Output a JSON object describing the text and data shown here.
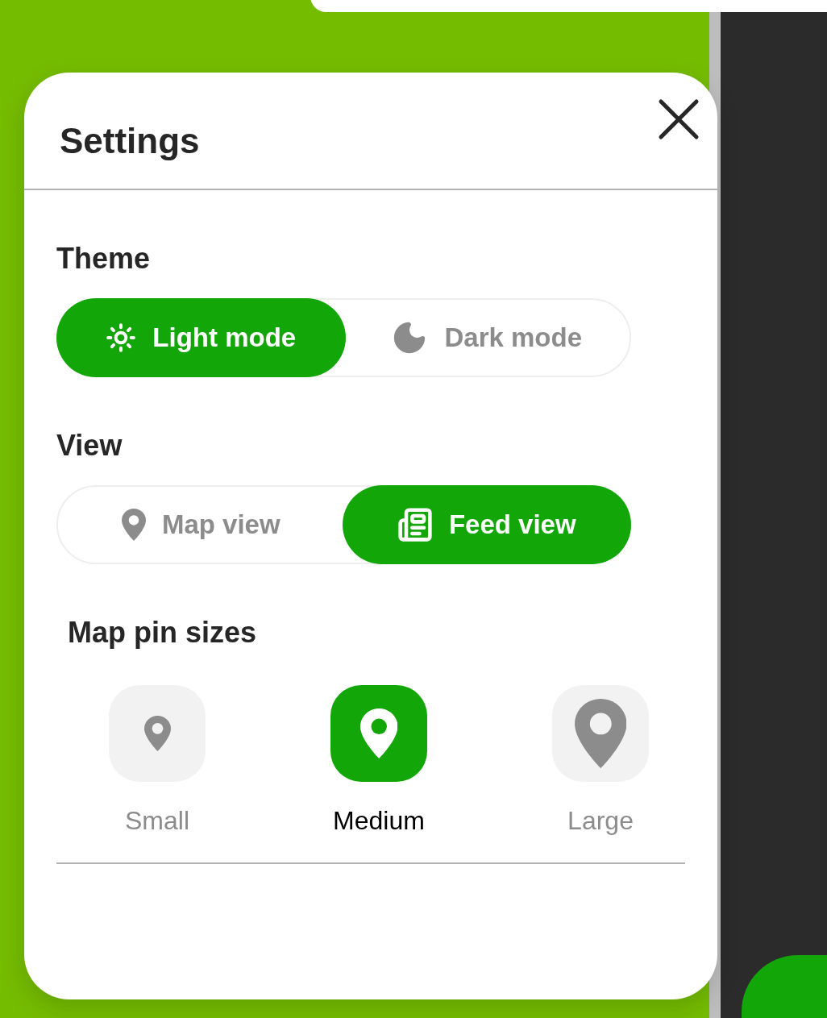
{
  "title": "Settings",
  "sections": [
    {
      "kind": "toggle",
      "label": "Theme",
      "options": [
        {
          "label": "Light mode",
          "selected": true
        },
        {
          "label": "Dark mode",
          "selected": false
        }
      ]
    },
    {
      "kind": "toggle",
      "label": "View",
      "options": [
        {
          "label": "Map view",
          "selected": false
        },
        {
          "label": "Feed view",
          "selected": true
        }
      ]
    },
    {
      "kind": "sizes",
      "label": "Map pin sizes",
      "options": [
        {
          "label": "Small",
          "selected": false
        },
        {
          "label": "Medium",
          "selected": true
        },
        {
          "label": "Large",
          "selected": false
        }
      ]
    }
  ]
}
